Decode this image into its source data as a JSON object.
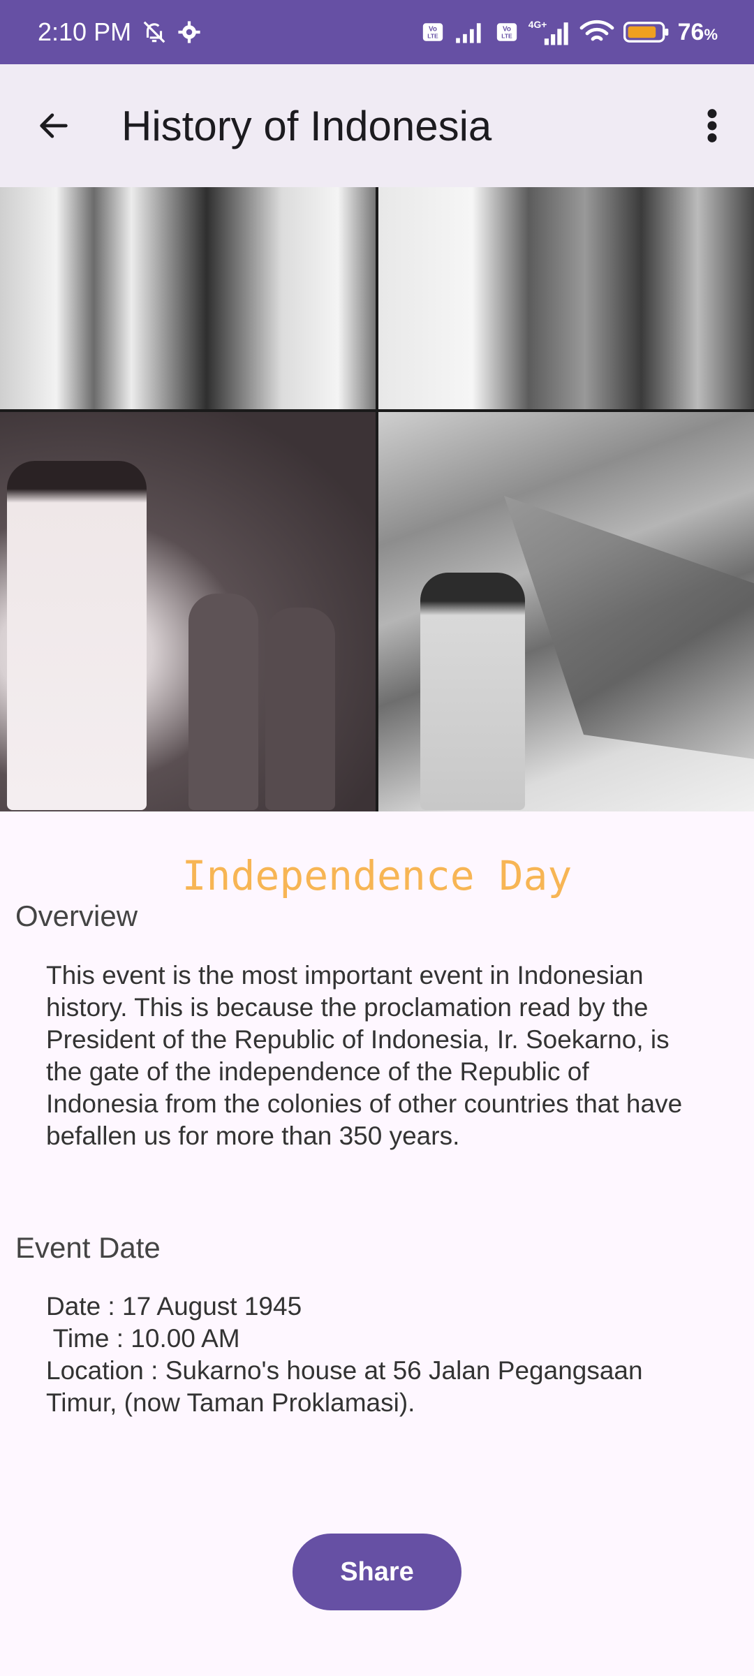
{
  "status_bar": {
    "time": "2:10 PM",
    "battery": "76",
    "battery_unit": "%",
    "icons": [
      "bell-off-icon",
      "gear-icon",
      "volte-icon",
      "signal-icon",
      "4g-icon",
      "wifi-icon",
      "battery-icon"
    ]
  },
  "app_bar": {
    "title": "History of Indonesia",
    "back_icon": "arrow-left-icon",
    "more_icon": "more-vert-icon"
  },
  "event": {
    "title": "Independence Day"
  },
  "overview": {
    "heading": "Overview",
    "text": "This event is the most important event in Indonesian history. This is because the proclamation read by the President of the Republic of Indonesia, Ir. Soekarno, is the gate of the independence of the Republic of Indonesia from the colonies of other countries that have befallen us for more than 350 years."
  },
  "event_date": {
    "heading": "Event Date",
    "date_line": "Date : 17 August 1945",
    "time_line": " Time : 10.00 AM",
    "location_line": " Location : Sukarno's house at 56 Jalan Pegangsaan Timur, (now Taman Proklamasi)."
  },
  "share_button": {
    "label": "Share"
  },
  "colors": {
    "primary": "#6650a4",
    "title_accent": "#f7b554",
    "background": "#fef7ff",
    "app_bar": "#f0ebf4"
  }
}
